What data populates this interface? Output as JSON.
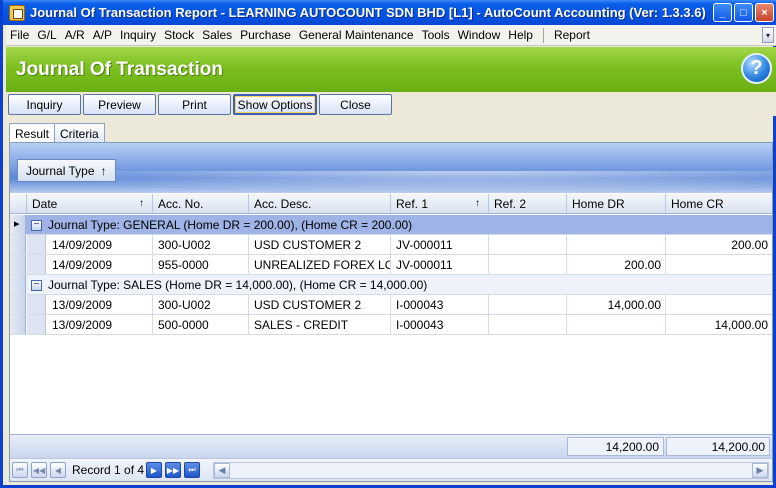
{
  "window": {
    "title": "Journal Of Transaction Report - LEARNING AUTOCOUNT SDN BHD [L1] - AutoCount Accounting (Ver: 1.3.3.6)",
    "min_label": "_",
    "max_label": "□",
    "close_label": "×"
  },
  "menu": {
    "items": [
      "File",
      "G/L",
      "A/R",
      "A/P",
      "Inquiry",
      "Stock",
      "Sales",
      "Purchase",
      "General Maintenance",
      "Tools",
      "Window",
      "Help"
    ],
    "extra": "Report",
    "dropdown_glyph": "▾"
  },
  "header": {
    "title": "Journal Of Transaction",
    "help_glyph": "?"
  },
  "toolbar": {
    "inquiry": "Inquiry",
    "preview": "Preview",
    "print": "Print",
    "show_options": "Show Options",
    "close": "Close"
  },
  "tabs": {
    "result": "Result",
    "criteria": "Criteria"
  },
  "group_panel": {
    "chip_label": "Journal Type",
    "sort_glyph": "↑"
  },
  "grid": {
    "columns": [
      "Date",
      "Acc. No.",
      "Acc. Desc.",
      "Ref. 1",
      "Ref. 2",
      "Home DR",
      "Home CR"
    ],
    "sort_glyph": "↑",
    "groups": [
      {
        "label": "Journal Type: GENERAL (Home DR = 200.00), (Home CR = 200.00)",
        "expander": "−",
        "rows": [
          [
            "14/09/2009",
            "300-U002",
            "USD CUSTOMER 2",
            "JV-000011",
            "",
            "",
            "200.00"
          ],
          [
            "14/09/2009",
            "955-0000",
            "UNREALIZED  FOREX LOSS",
            "JV-000011",
            "",
            "200.00",
            ""
          ]
        ]
      },
      {
        "label": "Journal Type: SALES (Home DR = 14,000.00), (Home CR = 14,000.00)",
        "expander": "−",
        "rows": [
          [
            "13/09/2009",
            "300-U002",
            "USD CUSTOMER 2",
            "I-000043",
            "",
            "14,000.00",
            ""
          ],
          [
            "13/09/2009",
            "500-0000",
            "SALES - CREDIT",
            "I-000043",
            "",
            "",
            "14,000.00"
          ]
        ]
      }
    ],
    "totals": {
      "home_dr": "14,200.00",
      "home_cr": "14,200.00"
    }
  },
  "navigator": {
    "record_text": "Record 1 of 4",
    "first": "⏮",
    "prev_page": "◀◀",
    "prev": "◀",
    "next": "▶",
    "next_page": "▶▶",
    "last": "⏭",
    "scroll_left": "◀",
    "scroll_right": "▶"
  }
}
